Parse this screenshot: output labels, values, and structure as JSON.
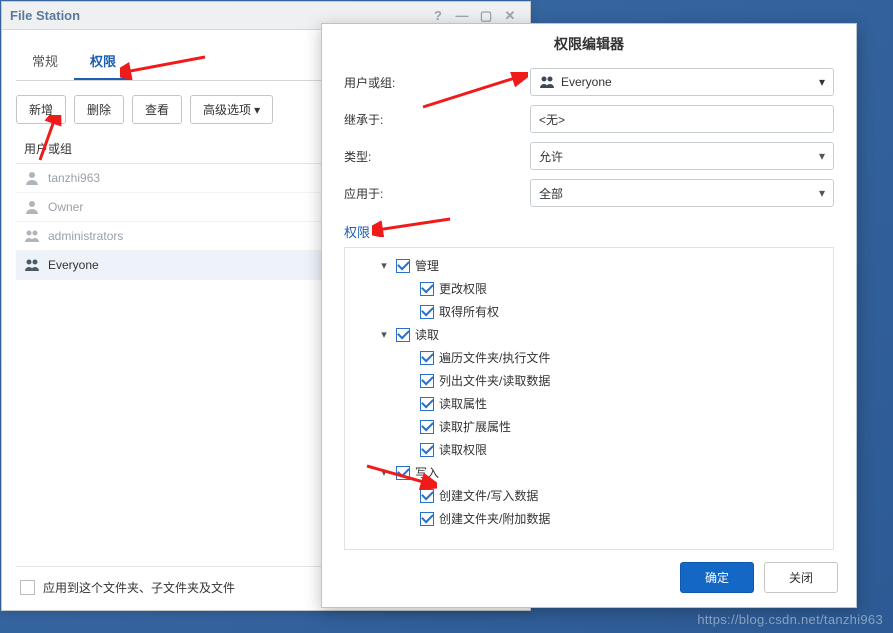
{
  "fileStation": {
    "title": "File Station",
    "tabs": {
      "general": "常规",
      "permissions": "权限"
    },
    "toolbar": {
      "add": "新增",
      "delete": "删除",
      "view": "查看",
      "advanced": "高级选项"
    },
    "gridHeader": "用户或组",
    "users": [
      {
        "name": "tanzhi963",
        "selected": false
      },
      {
        "name": "Owner",
        "selected": false
      },
      {
        "name": "administrators",
        "selected": false
      },
      {
        "name": "Everyone",
        "selected": true
      }
    ],
    "applyRecursive": "应用到这个文件夹、子文件夹及文件"
  },
  "editor": {
    "title": "权限编辑器",
    "labels": {
      "userOrGroup": "用户或组:",
      "inherit": "继承于:",
      "type": "类型:",
      "applyTo": "应用于:"
    },
    "values": {
      "userOrGroup": "Everyone",
      "inherit": "<无>",
      "type": "允许",
      "applyTo": "全部"
    },
    "sectionTitle": "权限",
    "tree": {
      "admin": {
        "label": "管理",
        "changePerm": "更改权限",
        "takeOwner": "取得所有权"
      },
      "read": {
        "label": "读取",
        "traverse": "遍历文件夹/执行文件",
        "list": "列出文件夹/读取数据",
        "readAttr": "读取属性",
        "readExtAttr": "读取扩展属性",
        "readPerm": "读取权限"
      },
      "write": {
        "label": "写入",
        "createFiles": "创建文件/写入数据",
        "createFolders": "创建文件夹/附加数据"
      }
    },
    "buttons": {
      "ok": "确定",
      "close": "关闭"
    }
  },
  "watermark": "https://blog.csdn.net/tanzhi963"
}
